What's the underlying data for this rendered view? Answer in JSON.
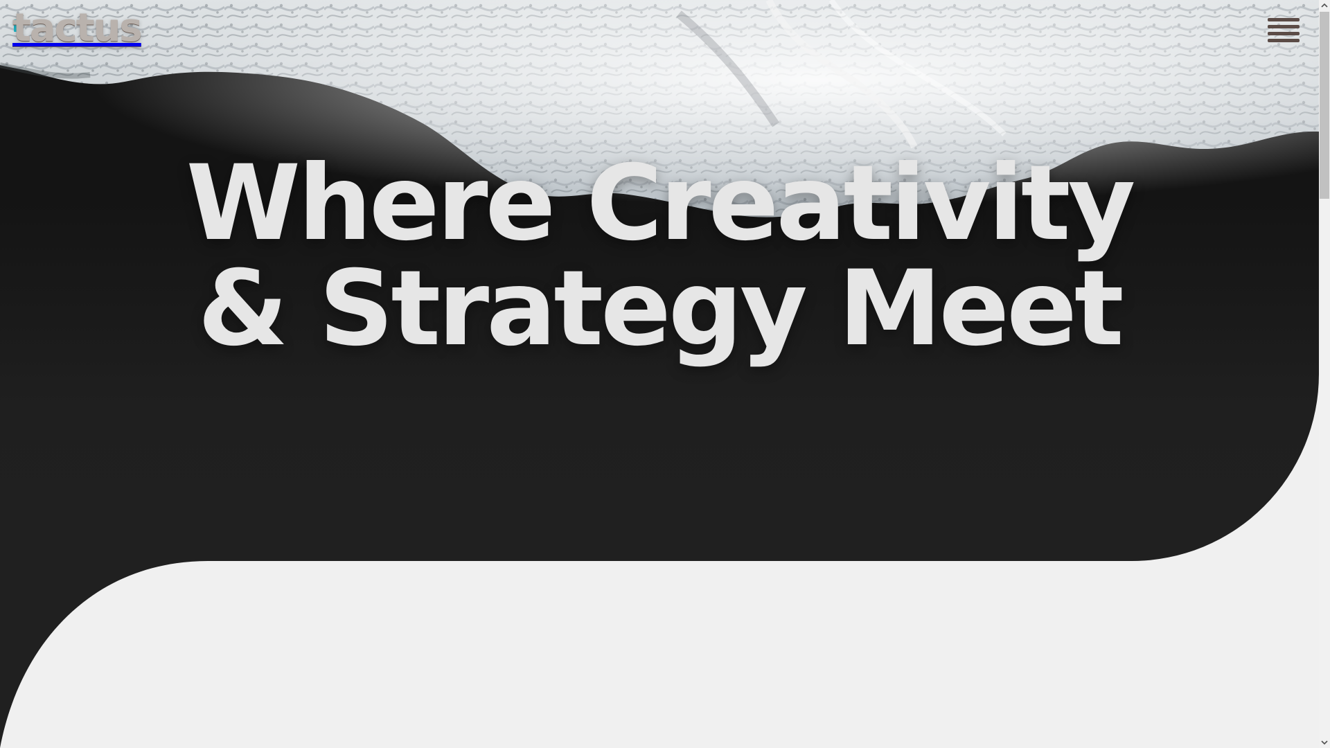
{
  "brand": {
    "logo_text": "tactus",
    "logo_accent_color": "#1fb7c8"
  },
  "header": {
    "menu_icon": "hamburger-menu-icon"
  },
  "hero": {
    "title_line_1": "Where Creativity",
    "title_line_2": "& Strategy Meet",
    "background_color": "#202020",
    "text_color": "#e6e6e6"
  },
  "page": {
    "lower_background_color": "#f0f0f0"
  },
  "scrollbar": {
    "up_icon": "scroll-up-arrow-icon",
    "down_icon": "scroll-down-arrow-icon"
  }
}
